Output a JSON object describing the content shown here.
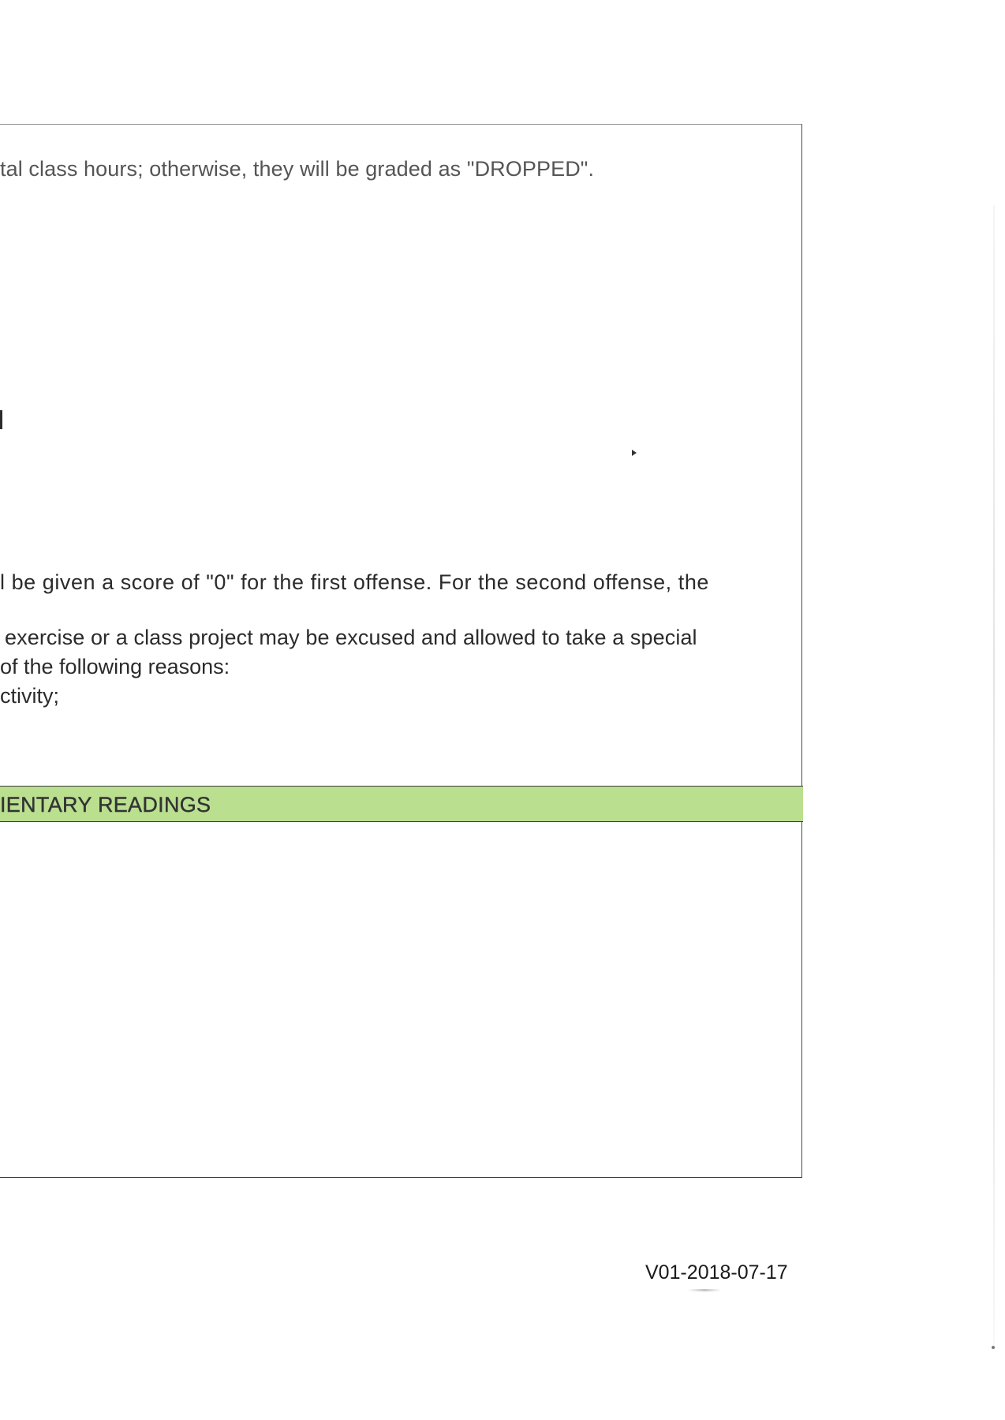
{
  "document": {
    "lines": {
      "attendance": "tal class hours; otherwise, they will be graded as \"DROPPED\".",
      "offense": "l be given a score of \"0\" for the first offense. For the second offense, the",
      "exercise": "exercise or a class project may be excused and allowed to take a special",
      "reasons": "of the following reasons:",
      "activity": "ctivity;"
    },
    "section_header": "IENTARY READINGS",
    "version": "V01-2018-07-17"
  }
}
